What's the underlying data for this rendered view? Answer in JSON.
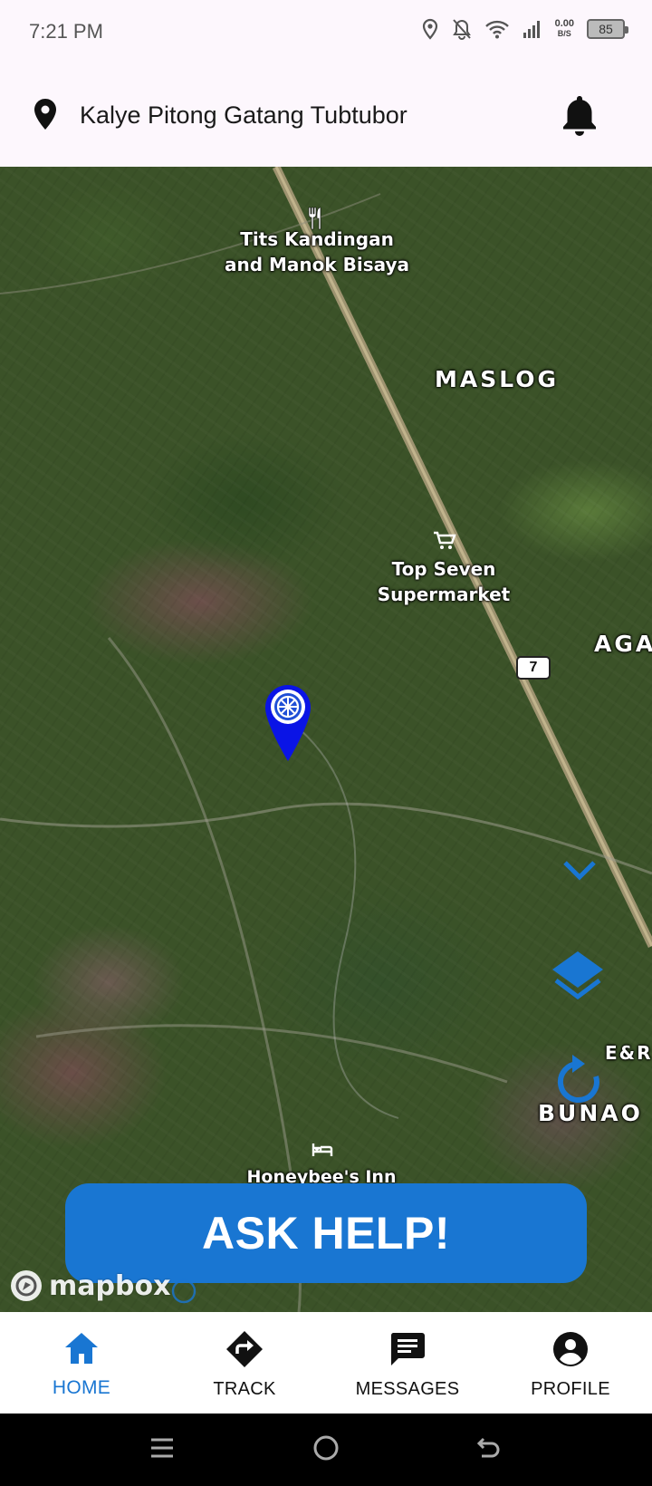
{
  "status_bar": {
    "time": "7:21 PM",
    "net_speed_value": "0.00",
    "net_speed_unit": "B/S",
    "battery": "85"
  },
  "header": {
    "location": "Kalye Pitong Gatang Tubtubor"
  },
  "map": {
    "labels": {
      "restaurant": "Tits Kandingan\nand Manok Bisaya",
      "district_maslog": "MASLOG",
      "supermarket": "Top Seven\nSupermarket",
      "district_aga": "AGA",
      "road_number": "7",
      "shop_er": "E&R",
      "district_bunao": "BUNAO",
      "inn": "Honeybee's Inn"
    },
    "attribution": "mapbox"
  },
  "ask_help_button": "ASK HELP!",
  "bottom_nav": {
    "items": [
      {
        "label": "HOME",
        "icon": "home-icon",
        "active": true
      },
      {
        "label": "TRACK",
        "icon": "directions-icon",
        "active": false
      },
      {
        "label": "MESSAGES",
        "icon": "message-icon",
        "active": false
      },
      {
        "label": "PROFILE",
        "icon": "profile-icon",
        "active": false
      }
    ]
  },
  "colors": {
    "primary": "#1976d2",
    "marker": "#0a14e6",
    "header_bg": "#fdf7fd"
  }
}
